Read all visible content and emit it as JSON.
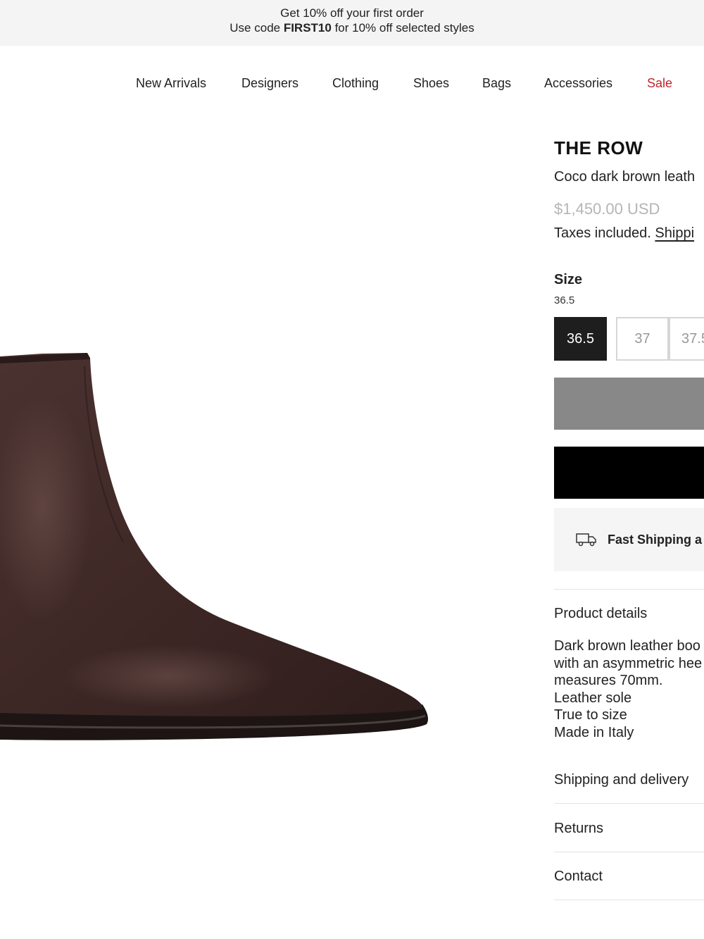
{
  "promo": {
    "line1": "Get 10% off your first order",
    "line2_prefix": "Use code ",
    "line2_code": "FIRST10",
    "line2_suffix": " for 10% off selected styles"
  },
  "nav": {
    "items": [
      "New Arrivals",
      "Designers",
      "Clothing",
      "Shoes",
      "Bags",
      "Accessories",
      "Sale"
    ],
    "sale_color": "#c0262c"
  },
  "product": {
    "brand": "THE ROW",
    "name": "Coco dark brown leath",
    "price": "$1,450.00 USD",
    "taxes_text": "Taxes included. ",
    "shipping_link": "Shippi",
    "image_icon": "boot-photo"
  },
  "size": {
    "label": "Size",
    "selected": "36.5",
    "options": [
      "36.5",
      "37",
      "37.5"
    ]
  },
  "shipping_box": {
    "icon": "truck-icon",
    "text": "Fast Shipping a"
  },
  "accordion": {
    "product_details": "Product details",
    "details_lines": [
      "Dark brown leather boo",
      "with an asymmetric hee",
      "measures 70mm.",
      "Leather sole",
      "True to size",
      "Made in Italy"
    ],
    "shipping": "Shipping and delivery",
    "returns": "Returns",
    "contact": "Contact"
  },
  "colors": {
    "selected_size": "#1e1e1e",
    "grey_button": "#888888",
    "black_button": "#000000",
    "price": "#b5b5b5",
    "boot": "#3f2927"
  }
}
